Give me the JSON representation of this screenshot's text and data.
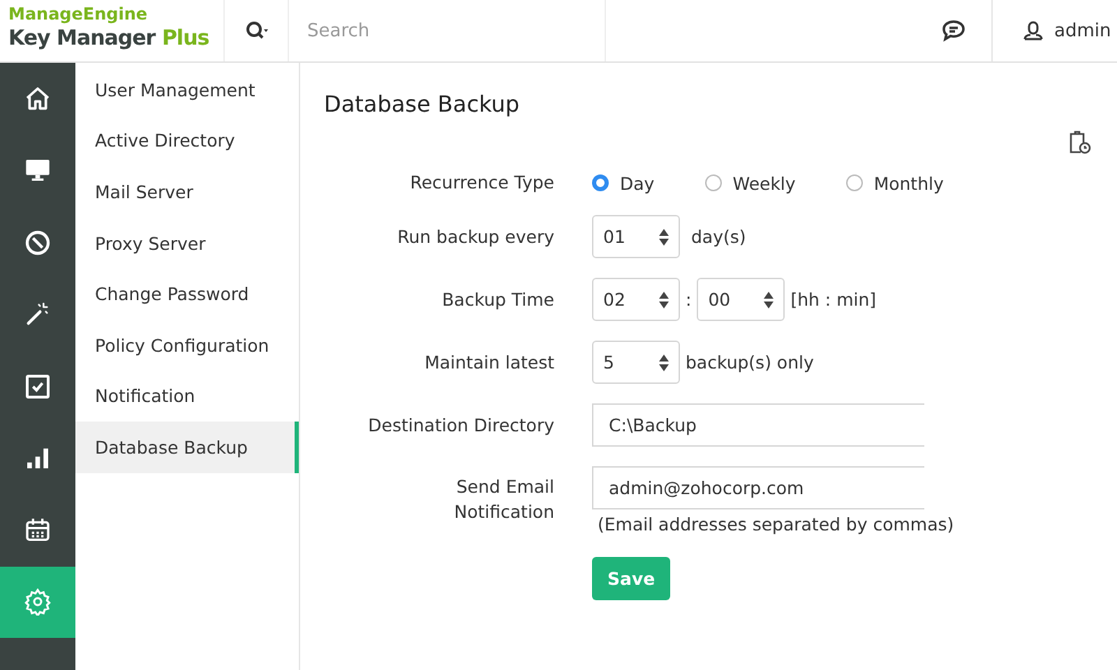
{
  "brand": {
    "company": "ManageEngine",
    "product": "Key Manager",
    "edition": "Plus"
  },
  "header": {
    "search": {
      "placeholder": "Search"
    },
    "user": "admin"
  },
  "rail": [
    {
      "kind": "home",
      "selected": false
    },
    {
      "kind": "monitor",
      "selected": false
    },
    {
      "kind": "block",
      "selected": false
    },
    {
      "kind": "wand",
      "selected": false
    },
    {
      "kind": "task",
      "selected": false
    },
    {
      "kind": "chart",
      "selected": false
    },
    {
      "kind": "calendar",
      "selected": false
    },
    {
      "kind": "gear",
      "selected": true
    }
  ],
  "submenu": [
    {
      "label": "User Management",
      "selected": false
    },
    {
      "label": "Active Directory",
      "selected": false
    },
    {
      "label": "Mail Server",
      "selected": false
    },
    {
      "label": "Proxy Server",
      "selected": false
    },
    {
      "label": "Change Password",
      "selected": false
    },
    {
      "label": "Policy Configuration",
      "selected": false
    },
    {
      "label": "Notification",
      "selected": false
    },
    {
      "label": "Database Backup",
      "selected": true
    }
  ],
  "page": {
    "title": "Database Backup",
    "recurrence": {
      "label": "Recurrence Type",
      "options": [
        {
          "label": "Day",
          "selected": true
        },
        {
          "label": "Weekly",
          "selected": false
        },
        {
          "label": "Monthly",
          "selected": false
        }
      ]
    },
    "run_every": {
      "label": "Run backup every",
      "value": "01",
      "unit": "day(s)"
    },
    "backup_time": {
      "label": "Backup Time",
      "hours": "02",
      "separator": ":",
      "minutes": "00",
      "unit": "[hh : min]"
    },
    "maintain": {
      "label": "Maintain latest",
      "value": "5",
      "unit": "backup(s) only"
    },
    "destination": {
      "label": "Destination Directory",
      "value": "C:\\Backup"
    },
    "email": {
      "label": "Send Email Notification",
      "value": "admin@zohocorp.com",
      "hint": "(Email addresses separated by commas)"
    },
    "save": "Save"
  }
}
